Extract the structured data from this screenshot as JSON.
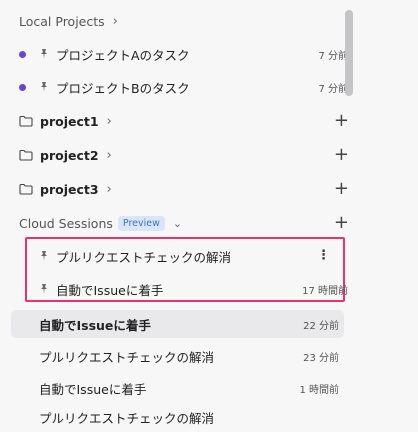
{
  "local_projects": {
    "header": "Local Projects",
    "tasks": [
      {
        "title": "プロジェクトAのタスク",
        "time": "7 分前"
      },
      {
        "title": "プロジェクトBのタスク",
        "time": "7 分前"
      }
    ],
    "folders": [
      "project1",
      "project2",
      "project3"
    ]
  },
  "cloud_sessions": {
    "header": "Cloud Sessions",
    "badge": "Preview",
    "highlighted": [
      {
        "title": "プルリクエストチェックの解消",
        "time": ""
      },
      {
        "title": "自動でIssueに着手",
        "time": "17 時間前"
      }
    ],
    "sessions": [
      {
        "title": "自動でIssueに着手",
        "time": "22 分前"
      },
      {
        "title": "プルリクエストチェックの解消",
        "time": "23 分前"
      },
      {
        "title": "自動でIssueに着手",
        "time": "1 時間前"
      },
      {
        "title": "プルリクエストチェックの解消",
        "time": ""
      }
    ]
  },
  "icons": {
    "chevron": "chevron-right-icon",
    "chevron_down": "chevron-down-icon",
    "pin": "pin-icon",
    "folder": "folder-icon",
    "plus": "plus-icon",
    "more": "more-vertical-icon"
  },
  "colors": {
    "accent_dot": "#6a44d6",
    "highlight_border": "#e8336d",
    "badge_text": "#3d73c8",
    "badge_bg": "#d9e6fa",
    "active_row_bg": "#e9e8eb"
  }
}
